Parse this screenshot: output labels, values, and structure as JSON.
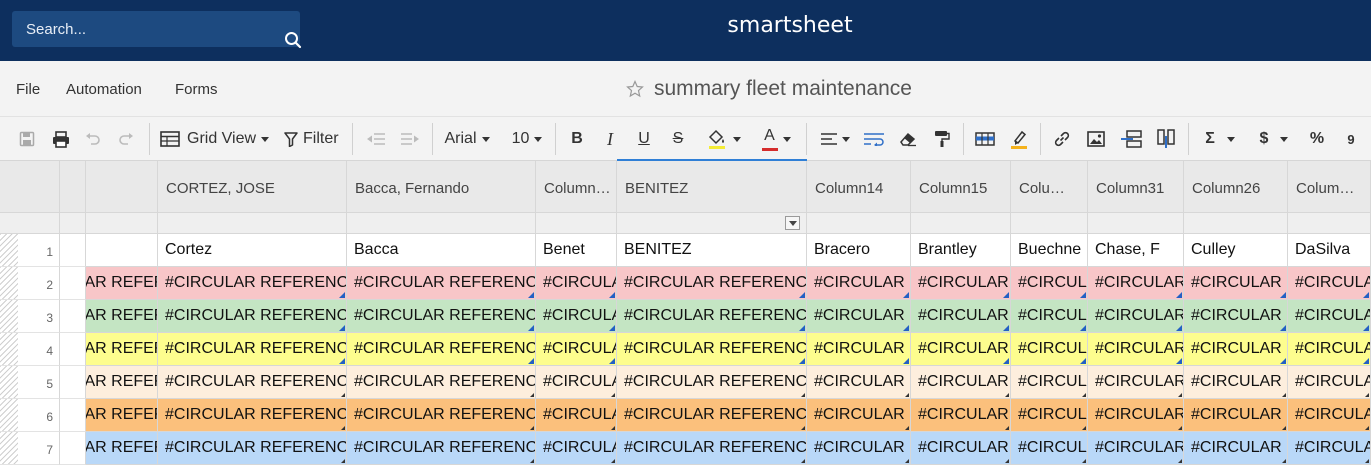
{
  "app": {
    "brand": "smartsheet",
    "search_placeholder": "Search..."
  },
  "menu": {
    "file": "File",
    "automation": "Automation",
    "forms": "Forms"
  },
  "sheet": {
    "title": "summary fleet maintenance"
  },
  "toolbar": {
    "view_label": "Grid View",
    "filter_label": "Filter",
    "font_name": "Arial",
    "font_size": "10",
    "bold": "B",
    "italic": "I",
    "underline": "U",
    "strike": "S",
    "text_color": "A",
    "sum": "Σ",
    "currency": "$",
    "percent": "%",
    "comma": "9"
  },
  "colors": {
    "topbar": "#0d2f5e",
    "row2": "#f8c6c8",
    "row3": "#c4e5c3",
    "row4": "#fdfd8e",
    "row5": "#fdeedd",
    "row6": "#fbc07c",
    "row7": "#b9d8f8",
    "accent": "#2f7fd6"
  },
  "grid": {
    "columns": [
      "CORTEZ, JOSE",
      "Bacca, Fernando",
      "Column…",
      "BENITEZ",
      "Column14",
      "Column15",
      "Colu…",
      "Column31",
      "Column26",
      "Colum…"
    ],
    "row_numbers": [
      "1",
      "2",
      "3",
      "4",
      "5",
      "6",
      "7"
    ],
    "row1": [
      "Cortez",
      "Bacca",
      "Benet",
      "BENITEZ",
      "Bracero",
      "Brantley",
      "Buechne",
      "Chase, F",
      "Culley",
      "DaSilva"
    ],
    "error_text": "#CIRCULAR REFERENCE",
    "first_col_error": "#CIRCULAR REFERENCE"
  }
}
